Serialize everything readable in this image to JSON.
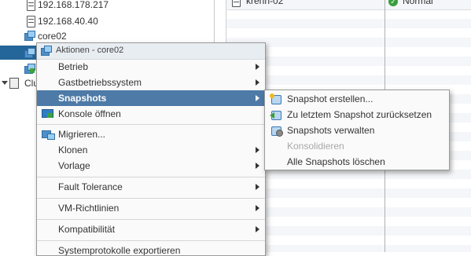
{
  "tree": {
    "items": [
      {
        "label": "192.168.178.217",
        "icon": "host-icon"
      },
      {
        "label": "192.168.40.40",
        "icon": "host-icon"
      },
      {
        "label": "core02",
        "icon": "vm-icon"
      },
      {
        "label": "",
        "icon": "vm-icon"
      },
      {
        "label": "",
        "icon": "vm-icon"
      },
      {
        "label": "Clu",
        "icon": "cluster-icon"
      }
    ]
  },
  "grid": {
    "row0_name": "krenn-02",
    "row0_status": "Normal",
    "status_icon": "check-icon"
  },
  "menu": {
    "header": "Aktionen - core02",
    "items": [
      {
        "label": "Betrieb",
        "submenu": true
      },
      {
        "label": "Gastbetriebssystem",
        "submenu": true
      },
      {
        "label": "Snapshots",
        "submenu": true,
        "active": true
      },
      {
        "label": "Konsole öffnen",
        "icon": "console-icon"
      },
      {
        "label": "Migrieren...",
        "icon": "migrate-icon"
      },
      {
        "label": "Klonen",
        "submenu": true
      },
      {
        "label": "Vorlage",
        "submenu": true
      },
      {
        "label": "Fault Tolerance",
        "submenu": true
      },
      {
        "label": "VM-Richtlinien",
        "submenu": true
      },
      {
        "label": "Kompatibilität",
        "submenu": true
      },
      {
        "label": "Systemprotokolle exportieren"
      }
    ]
  },
  "submenu": {
    "items": [
      {
        "label": "Snapshot erstellen...",
        "icon": "snapshot-create-icon"
      },
      {
        "label": "Zu letztem Snapshot zurücksetzen",
        "icon": "snapshot-revert-icon"
      },
      {
        "label": "Snapshots verwalten",
        "icon": "snapshot-manager-icon"
      },
      {
        "label": "Konsolidieren",
        "disabled": true
      },
      {
        "label": "Alle Snapshots löschen"
      }
    ]
  },
  "colors": {
    "menu_active": "#4d7aa6",
    "tree_selected": "#246699",
    "status_ok": "#3a9d3a"
  }
}
